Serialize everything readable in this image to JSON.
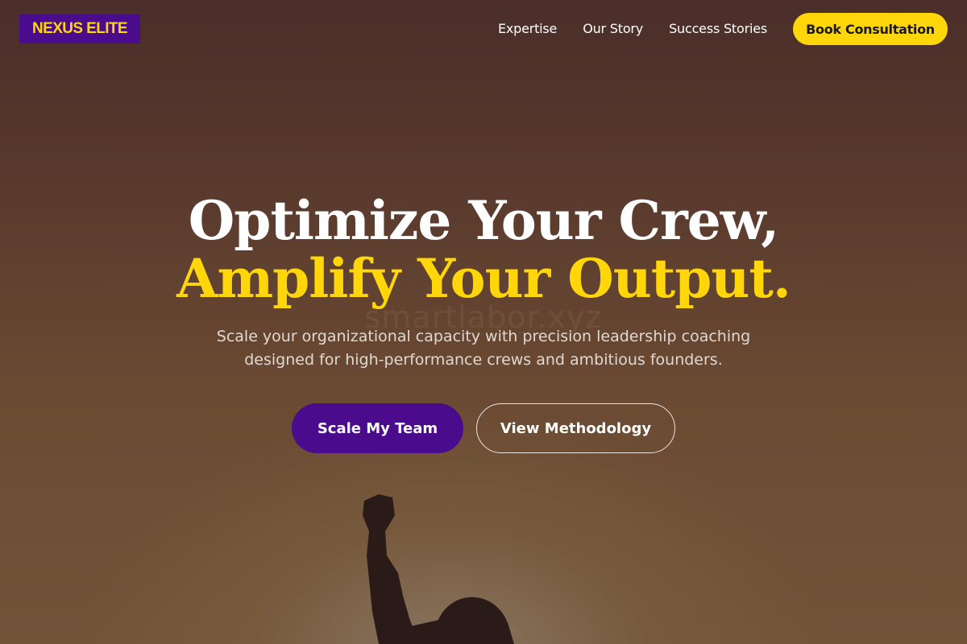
{
  "brand": {
    "logo_text": "NEXUS ELITE"
  },
  "nav": {
    "links": [
      "Expertise",
      "Our Story",
      "Success Stories"
    ],
    "cta_label": "Book Consultation"
  },
  "hero": {
    "headline_line1": "Optimize Your Crew,",
    "headline_line2": "Amplify Your Output.",
    "subtitle": "Scale your organizational capacity with precision leadership coaching designed for high-performance crews and ambitious founders.",
    "primary_button": "Scale My Team",
    "secondary_button": "View Methodology",
    "watermark": "smartlabor.xyz"
  },
  "colors": {
    "accent": "#ffd60a",
    "brand_purple": "#4a0b8c"
  }
}
